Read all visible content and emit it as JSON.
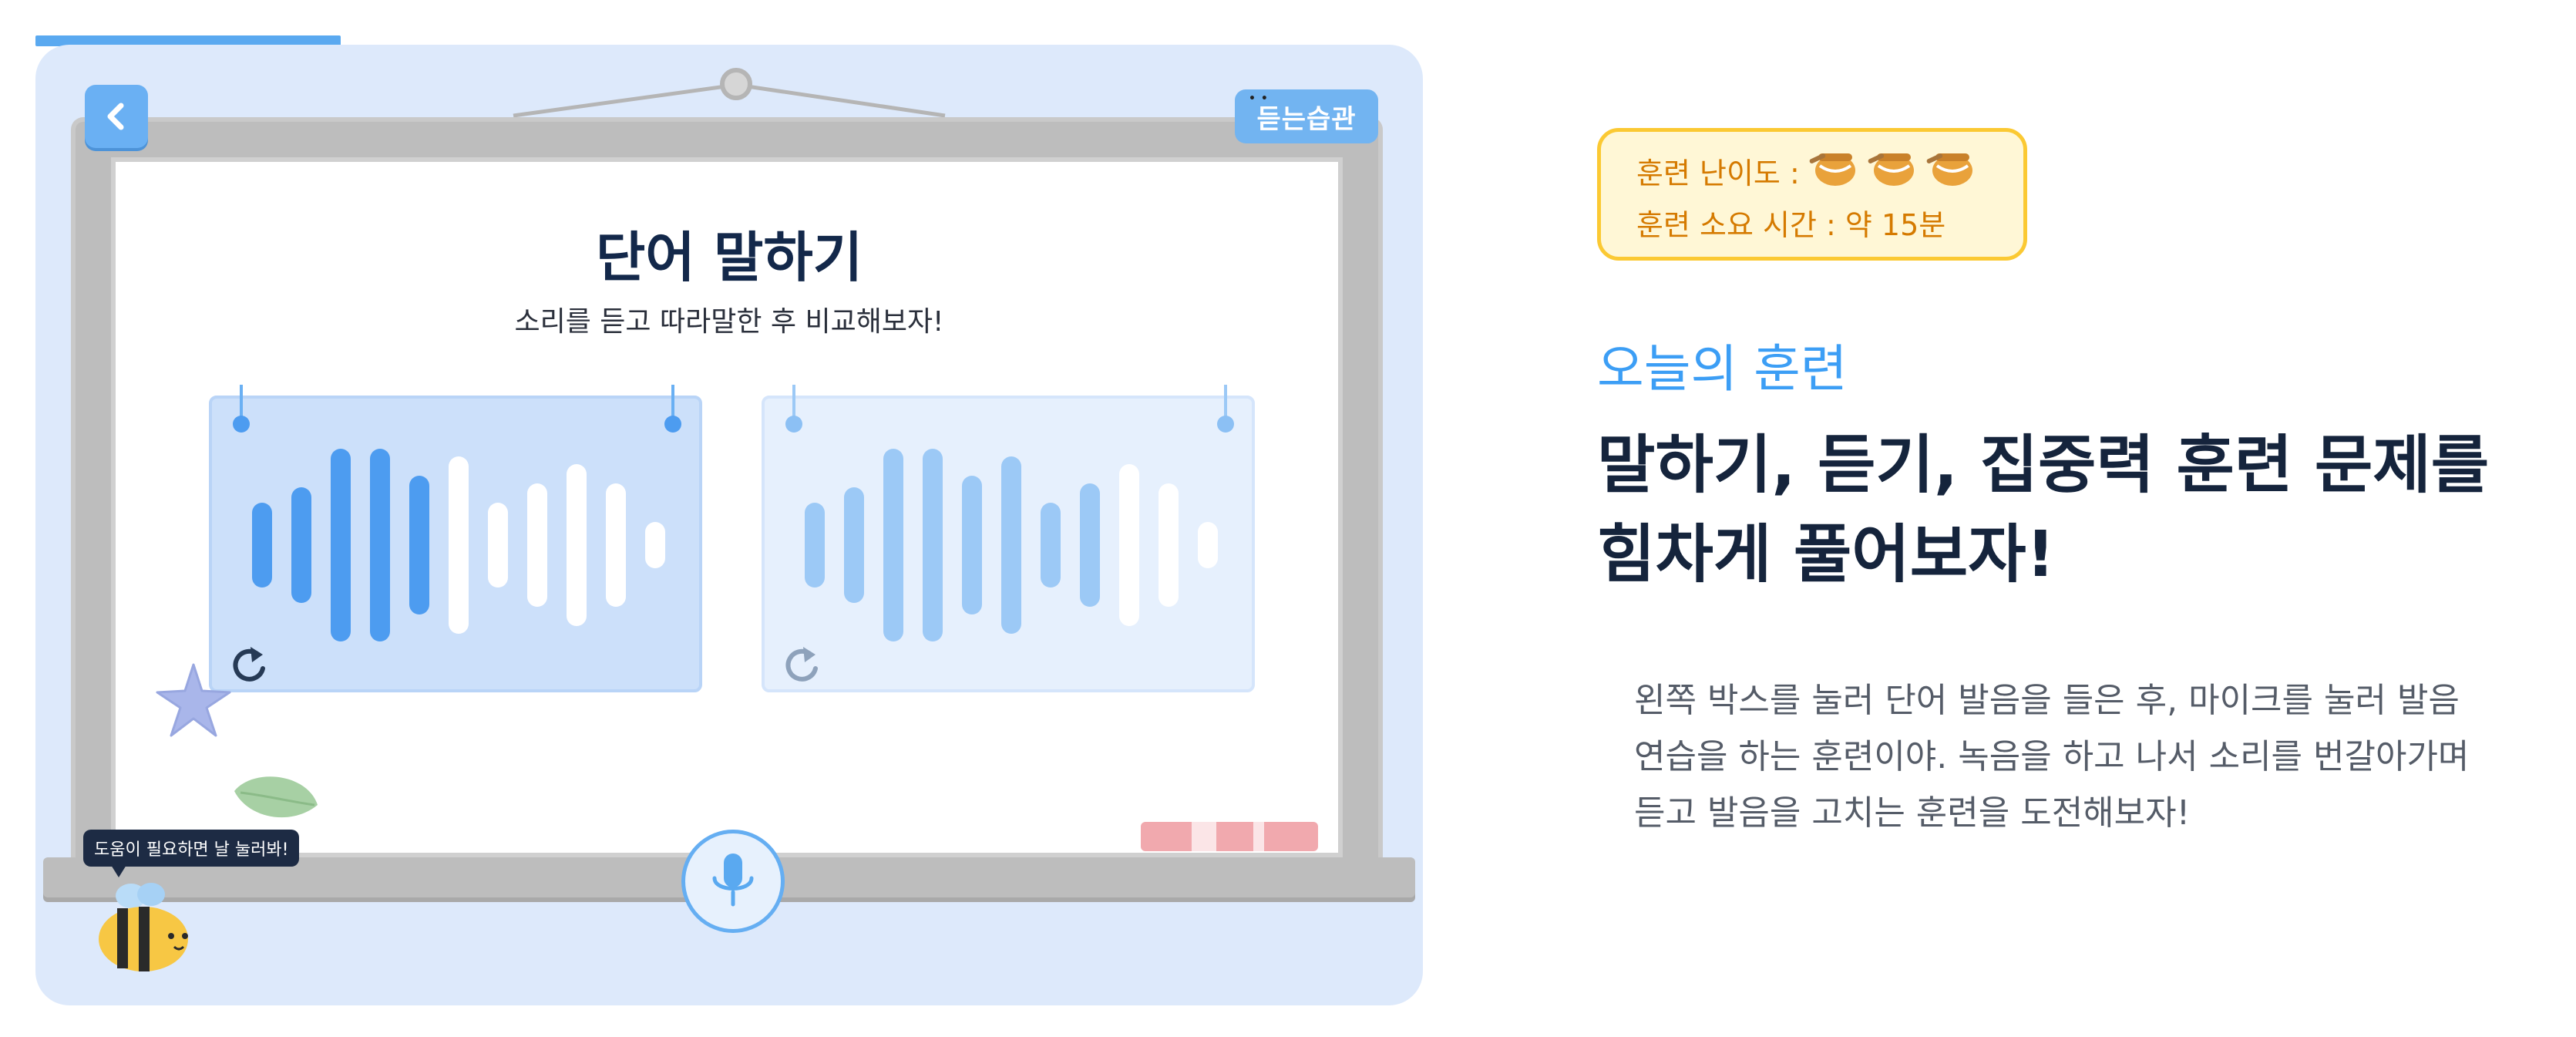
{
  "progress": {
    "fraction": 0.22
  },
  "header": {
    "logo_text": "듣는습관"
  },
  "game": {
    "title": "단어 말하기",
    "subtitle": "소리를 듣고 따라말한 후 비교해보자!"
  },
  "sound_cards": [
    {
      "role": "listen",
      "played_fraction": 0.45
    },
    {
      "role": "record",
      "played_fraction": 0.7
    }
  ],
  "help": {
    "bubble_text": "도움이 필요하면 날 눌러봐!"
  },
  "icons": {
    "back": "chevron-left-icon",
    "replay": "replay-icon",
    "mic": "microphone-icon",
    "difficulty": "honey-pot-icon",
    "mascot": "bee-icon"
  },
  "info": {
    "difficulty_label": "훈련 난이도 :",
    "difficulty_level": 3,
    "duration_label": "훈련 소요 시간 : 약 15분"
  },
  "section": {
    "label": "오늘의 훈련",
    "headline_lines": [
      "말하기, 듣기, 집중력 훈련 문제를",
      "힘차게 풀어보자!"
    ],
    "description_lines": [
      "왼쪽 박스를 눌러 단어 발음을 들은 후, 마이크를 눌러 발음",
      "연습을 하는 훈련이야. 녹음을 하고 나서 소리를 번갈아가며",
      "듣고 발음을 고치는 훈련을 도전해보자!"
    ]
  },
  "colors": {
    "accent": "#5aa9f0",
    "panel_bg": "#dde9fb",
    "info_border": "#fbc933",
    "info_text": "#d57a00",
    "headline": "#15243c",
    "section_label": "#3c9ef5"
  }
}
